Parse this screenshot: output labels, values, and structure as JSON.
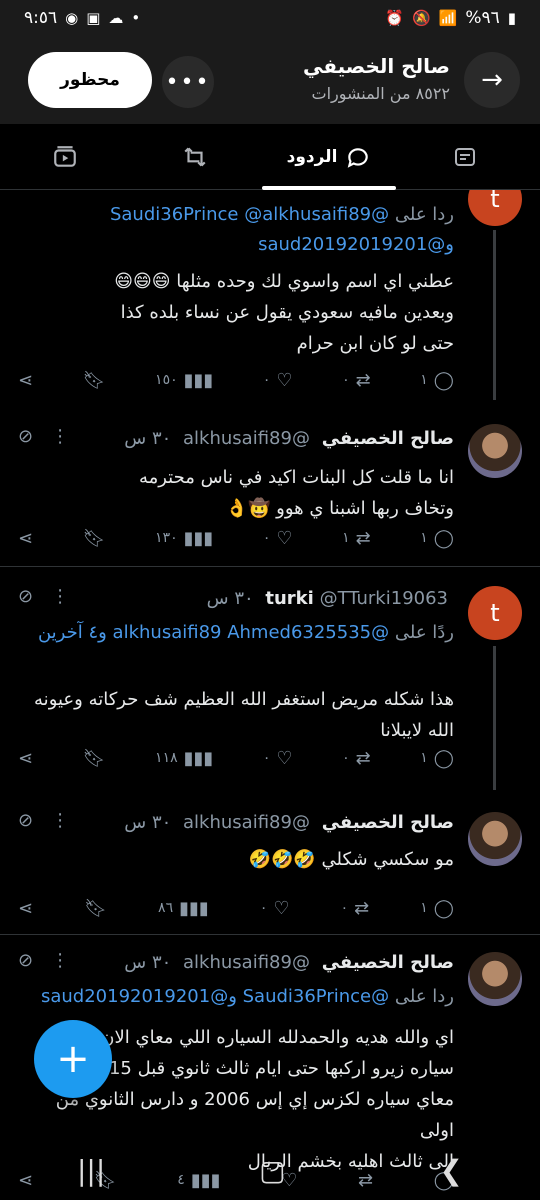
{
  "status_bar": {
    "time": "٩:٥٦",
    "battery": "%٩٦"
  },
  "header": {
    "name": "صالح الخصيفي",
    "posts_count": "٨٥٢٢ من المنشورات",
    "blocked_label": "محظور",
    "more_label": "•••"
  },
  "tabs": {
    "replies_label": "الردود"
  },
  "tweets": [
    {
      "replying_prefix": "ردا على",
      "replying_line1": "@Saudi36Prince @alkhusaifi89",
      "replying_line2": "و@saud20192019201",
      "text": "عطني اي اسم واسوي لك وحده مثلها 😄😄😄\nوبعدين مافيه سعودي يقول عن نساء بلده كذا\nحتى لو كان ابن حرام",
      "replies": "١",
      "retweets": "٠",
      "likes": "٠",
      "views": "١٥٠"
    },
    {
      "name": "صالح الخصيفي",
      "handle": "@alkhusaifi89",
      "time": "٣٠ س",
      "text": "انا ما قلت كل البنات اكيد في ناس محترمه\nوتخاف ربها اشبنا ي هوو 🤠👌",
      "replies": "١",
      "retweets": "١",
      "likes": "٠",
      "views": "١٣٠"
    },
    {
      "name": "turki",
      "handle": "@TTurki19063",
      "time": "٣٠ س",
      "replying_prefix": "ردًا على",
      "replying_links": "@alkhusaifi89 Ahmed6325535",
      "replying_tail": "و٤ آخرين",
      "text": "هذا شكله مريض استغفر الله العظيم شف حركاته وعيونه\nالله لايبلانا",
      "replies": "١",
      "retweets": "٠",
      "likes": "٠",
      "views": "١١٨"
    },
    {
      "name": "صالح الخصيفي",
      "handle": "@alkhusaifi89",
      "time": "٣٠ س",
      "text": "مو سكسي شكلي 🤣🤣🤣",
      "replies": "١",
      "retweets": "٠",
      "likes": "٠",
      "views": "٨٦"
    },
    {
      "name": "صالح الخصيفي",
      "handle": "@alkhusaifi89",
      "time": "٣٠ س",
      "replying_prefix": "ردا على",
      "replying_links": "@Saudi36Prince و@saud20192019201",
      "text": "اي والله هديه والحمدلله السياره اللي معاي الان ج\nسياره زيرو اركبها حتى ايام ثالث ثانوي قبل 15\nمعاي سياره لكزس إي إس 2006 و دارس الثانوي من اولى\nالى ثالث اهليه بخشم الريال",
      "replies": "",
      "retweets": "",
      "likes": "",
      "views": "٤"
    }
  ],
  "fab": {
    "label": "+"
  }
}
